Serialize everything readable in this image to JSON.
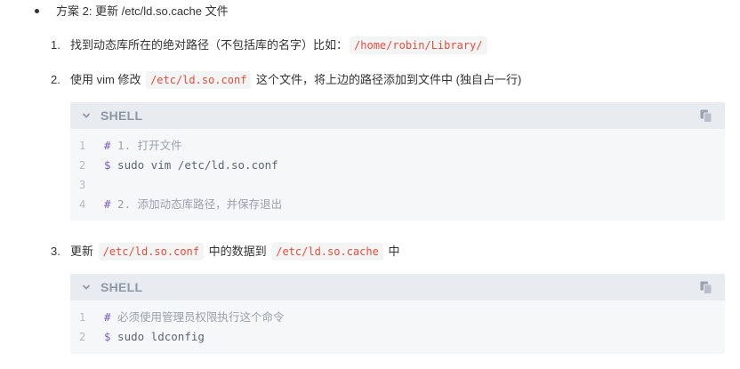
{
  "bullet": {
    "text": "方案 2: 更新 /etc/ld.so.cache 文件"
  },
  "steps": [
    {
      "num": "1.",
      "pre": "找到动态库所在的绝对路径（不包括库的名字）比如：",
      "code": "/home/robin/Library/",
      "post": ""
    },
    {
      "num": "2.",
      "pre": "使用 vim 修改 ",
      "code": "/etc/ld.so.conf",
      "post": " 这个文件，将上边的路径添加到文件中 (独自占一行)"
    },
    {
      "num": "3.",
      "pre": "更新 ",
      "code": "/etc/ld.so.conf",
      "mid": " 中的数据到 ",
      "code2": "/etc/ld.so.cache",
      "post": " 中"
    }
  ],
  "code_blocks": [
    {
      "lang": "SHELL",
      "lines": [
        {
          "n": "1",
          "sym": "#",
          "text": " 1. 打开文件"
        },
        {
          "n": "2",
          "sym": "$",
          "text": " sudo vim /etc/ld.so.conf"
        },
        {
          "n": "3",
          "sym": "",
          "text": ""
        },
        {
          "n": "4",
          "sym": "#",
          "text": " 2. 添加动态库路径，并保存退出"
        }
      ]
    },
    {
      "lang": "SHELL",
      "lines": [
        {
          "n": "1",
          "sym": "#",
          "text": " 必须使用管理员权限执行这个命令"
        },
        {
          "n": "2",
          "sym": "$",
          "text": " sudo ldconfig"
        }
      ]
    }
  ],
  "icons": {
    "collapse": "chevron-down-icon",
    "copy": "copy-icon"
  }
}
